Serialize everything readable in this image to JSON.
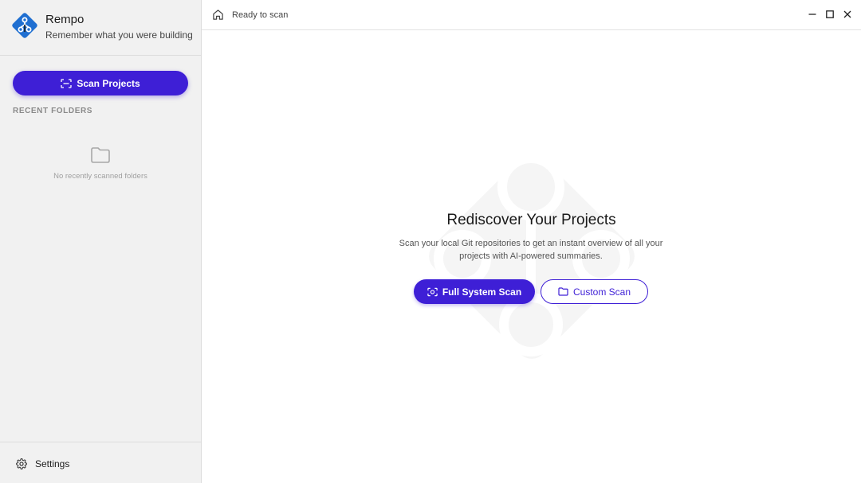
{
  "app": {
    "name": "Rempo",
    "tagline": "Remember what you were building"
  },
  "sidebar": {
    "scan_button_label": "Scan Projects",
    "recent_heading": "RECENT FOLDERS",
    "empty_text": "No recently scanned folders",
    "settings_label": "Settings"
  },
  "titlebar": {
    "status": "Ready to scan"
  },
  "main": {
    "title": "Rediscover Your Projects",
    "description": "Scan your local Git repositories to get an instant overview of all your projects with AI-powered summaries.",
    "full_scan_label": "Full System Scan",
    "custom_scan_label": "Custom Scan"
  },
  "colors": {
    "accent": "#3e1fd6",
    "sidebar_bg": "#f1f1f1",
    "logo_blue": "#1f6fd1"
  },
  "icons": {
    "logo": "git-diamond-logo",
    "scan": "scan-frame-icon",
    "folder": "folder-icon",
    "settings": "gear-icon",
    "home": "home-icon",
    "minimize": "minimize-icon",
    "maximize": "maximize-icon",
    "close": "close-icon"
  }
}
